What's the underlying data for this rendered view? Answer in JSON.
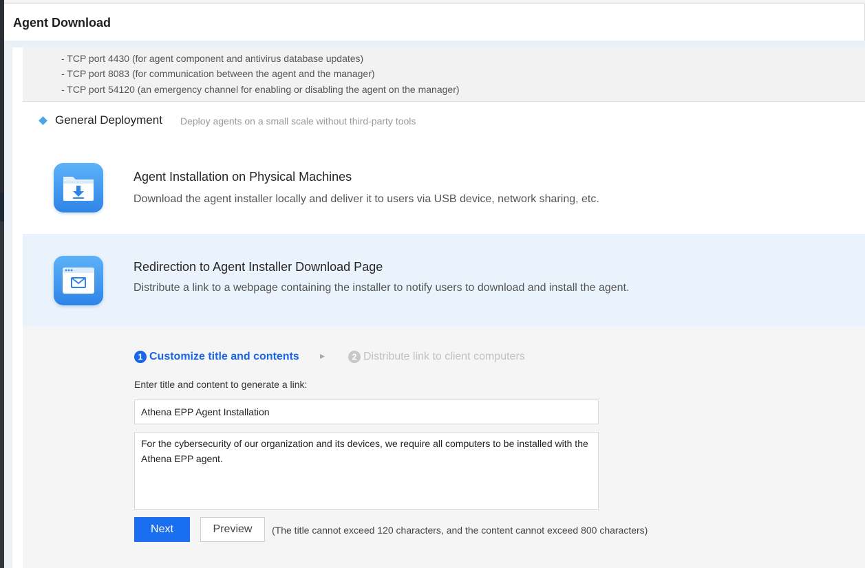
{
  "window": {
    "title": "Agent Download"
  },
  "ports": {
    "lines": [
      "- TCP port 4430 (for agent component and antivirus database updates)",
      "- TCP port 8083 (for communication between the agent and the manager)",
      "- TCP port 54120 (an emergency channel for enabling or disabling the agent on the manager)"
    ]
  },
  "section": {
    "name": "General Deployment",
    "description": "Deploy agents on a small scale without third-party tools"
  },
  "options": [
    {
      "title": "Agent Installation on Physical Machines",
      "description": "Download the agent installer locally and deliver it to users via USB device, network sharing, etc.",
      "icon": "folder-download-icon"
    },
    {
      "title": "Redirection to Agent Installer Download Page",
      "description": "Distribute a link to a webpage containing the installer to notify users to download and install the agent.",
      "icon": "browser-mail-icon"
    }
  ],
  "steps": [
    {
      "num": "1",
      "label": "Customize title and contents",
      "state": "active"
    },
    {
      "num": "2",
      "label": "Distribute link to client computers",
      "state": "inactive"
    }
  ],
  "form": {
    "prompt": "Enter title and content to generate a link:",
    "title_value": "Athena EPP Agent Installation",
    "content_value": "For the cybersecurity of our organization and its devices, we require all computers to be installed with the Athena EPP agent.",
    "next_label": "Next",
    "preview_label": "Preview",
    "hint": "(The title cannot exceed 120 characters, and the content cannot exceed 800 characters)"
  },
  "colors": {
    "accent": "#1a6ef0",
    "active_step": "#1a66e6",
    "diamond": "#4aa6e6",
    "selected_row": "#eaf2fb"
  }
}
